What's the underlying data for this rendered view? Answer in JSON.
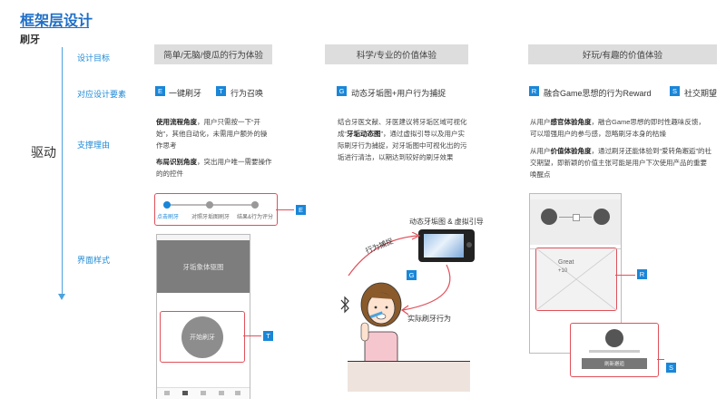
{
  "header": {
    "title": "框架层设计",
    "subtitle": "刷牙"
  },
  "rows": {
    "goal": "设计目标",
    "elements": "对应设计要素",
    "reason": "支撑理由",
    "ui": "界面样式"
  },
  "side_label": "驱动",
  "goals": [
    "简单/无脑/傻瓜的行为体验",
    "科学/专业的价值体验",
    "好玩/有趣的价值体验"
  ],
  "elements": [
    {
      "badge": "E",
      "label": "一键刷牙"
    },
    {
      "badge": "T",
      "label": "行为召唤"
    },
    {
      "badge": "G",
      "label": "动态牙垢图+用户行为捕捉"
    },
    {
      "badge": "R",
      "label": "融合Game思想的行为Reward"
    },
    {
      "badge": "S",
      "label": "社交期望"
    }
  ],
  "reasons": {
    "col1": [
      {
        "bold": "使用流程角度",
        "text": "，用户只需按一下“开始”，其他自动化，未需用户额外的操作思考"
      },
      {
        "bold": "布局识别角度",
        "text": "，突出用户唯一需要操作的的控件"
      }
    ],
    "col2": [
      {
        "pre": "结合牙医文献、牙医建议将牙垢区域可视化成“",
        "bold": "牙垢动态图",
        "post": "”，通过虚拟引导以及用户实际刷牙行为捕捉，对牙垢图中可视化出的污垢进行清洁，以期达到较好的刷牙效果"
      }
    ],
    "col3": [
      {
        "pre": "从用户",
        "bold": "感官体验角度",
        "post": "，融合Game思想的即时性趣味反馈，可以增强用户的参与感，忽略刷牙本身的枯燥"
      },
      {
        "pre": "从用户",
        "bold": "价值体验角度",
        "post": "，通过刷牙还能体验到“爱转角邂逅”的社交期望，即新颖的价值主张可能是用户下次使用产品的重要唤醒点"
      }
    ]
  },
  "ui": {
    "steps": [
      "点击刷牙",
      "对照牙垢图刷牙",
      "结果&行为评分"
    ],
    "step_badge": "E",
    "phone1": {
      "image_label": "牙垢象体驱图",
      "button_label": "开始刷牙",
      "badge": "T"
    },
    "illustration": {
      "top_label": "动态牙垢图 & 虚拟引导",
      "capture_label": "行为捕捉",
      "actual_label": "实际刷牙行为",
      "badge": "G"
    },
    "phone3": {
      "great_text": "Great",
      "score_text": "+10",
      "reward_badge": "R",
      "social_badge": "S",
      "card_button": "刷新邂逅"
    }
  },
  "colors": {
    "accent_blue": "#1a86d8",
    "line_blue": "#4aa3df",
    "highlight_red": "#e0505a",
    "goal_bg": "#dddddd"
  }
}
